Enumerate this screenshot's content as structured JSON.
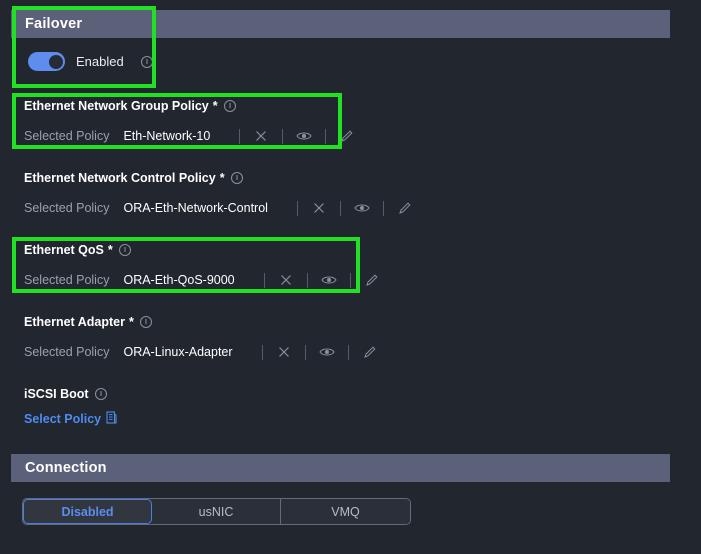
{
  "sections": {
    "failover": {
      "title": "Failover"
    },
    "connection": {
      "title": "Connection"
    }
  },
  "failover": {
    "toggle_label": "Enabled",
    "toggle_state": "on",
    "toggle_color": "#5f8ded",
    "info_icon": "info-icon"
  },
  "selected_policy_label": "Selected Policy",
  "required_marker": "*",
  "policies": [
    {
      "label": "Ethernet Network Group Policy",
      "required": true,
      "value": "Eth-Network-10",
      "actions": [
        "clear-icon",
        "view-icon",
        "edit-icon"
      ]
    },
    {
      "label": "Ethernet Network Control Policy",
      "required": true,
      "value": "ORA-Eth-Network-Control",
      "actions": [
        "clear-icon",
        "view-icon",
        "edit-icon"
      ]
    },
    {
      "label": "Ethernet QoS",
      "required": true,
      "value": "ORA-Eth-QoS-9000",
      "actions": [
        "clear-icon",
        "view-icon",
        "edit-icon"
      ]
    },
    {
      "label": "Ethernet Adapter",
      "required": true,
      "value": "ORA-Linux-Adapter",
      "actions": [
        "clear-icon",
        "view-icon",
        "edit-icon"
      ]
    }
  ],
  "iscsi_boot": {
    "label": "iSCSI Boot",
    "select_policy_label": "Select Policy",
    "select_policy_icon": "policy-list-icon"
  },
  "connection": {
    "options": [
      {
        "label": "Disabled",
        "selected": true
      },
      {
        "label": "usNIC",
        "selected": false
      },
      {
        "label": "VMQ",
        "selected": false
      }
    ]
  },
  "highlights": [
    {
      "name": "failover-highlight",
      "color": "#22e024"
    },
    {
      "name": "ethernet-network-group-policy-highlight",
      "color": "#22e024"
    },
    {
      "name": "ethernet-qos-highlight",
      "color": "#22e024"
    }
  ],
  "colors": {
    "background": "#22262f",
    "section_bar": "#5b6178",
    "accent_blue": "#5b8def",
    "link_blue": "#4e8bf0",
    "highlight_green": "#22e024",
    "muted_text": "#9aa0ac"
  }
}
